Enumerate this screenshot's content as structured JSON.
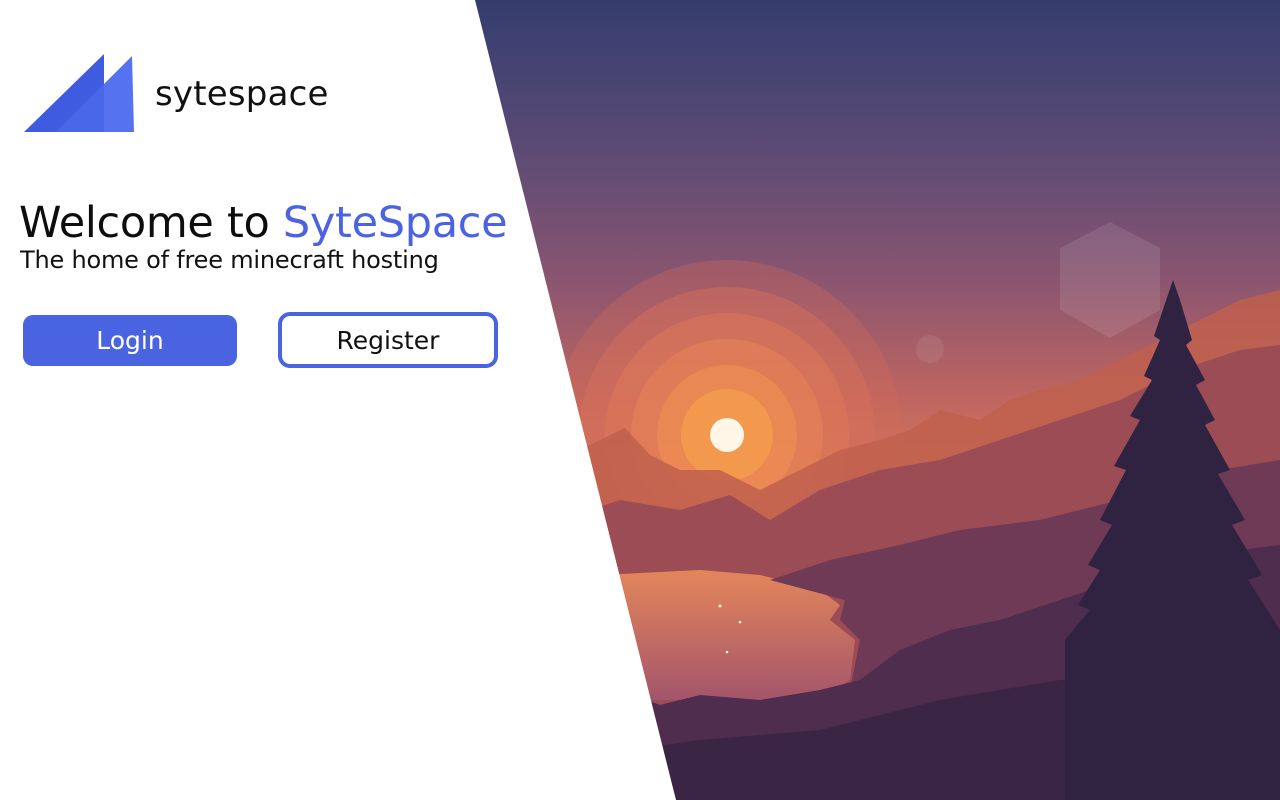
{
  "brand": {
    "name": "sytespace"
  },
  "hero": {
    "title_prefix": "Welcome to ",
    "title_accent": "SyteSpace",
    "subtitle": "The home of free minecraft hosting"
  },
  "actions": {
    "login_label": "Login",
    "register_label": "Register"
  },
  "colors": {
    "accent": "#4a63e0",
    "text": "#111111",
    "background": "#ffffff"
  }
}
